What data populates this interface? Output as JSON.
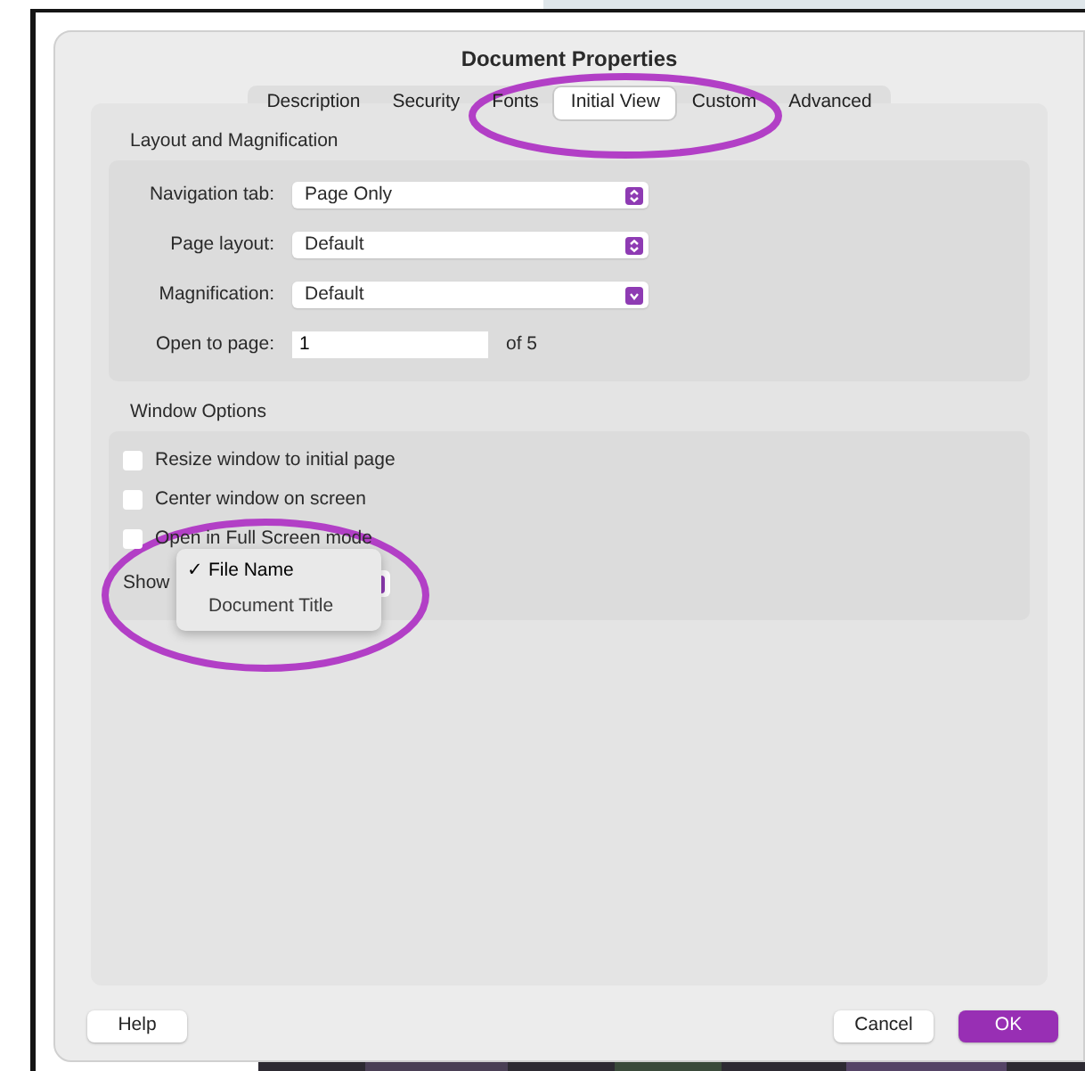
{
  "window": {
    "title": "Document Properties"
  },
  "tabs": [
    {
      "label": "Description",
      "selected": false
    },
    {
      "label": "Security",
      "selected": false
    },
    {
      "label": "Fonts",
      "selected": false
    },
    {
      "label": "Initial View",
      "selected": true
    },
    {
      "label": "Custom",
      "selected": false
    },
    {
      "label": "Advanced",
      "selected": false
    }
  ],
  "layout_group": {
    "title": "Layout and Magnification",
    "fields": [
      {
        "kind": "popup",
        "label": "Navigation tab:",
        "value": "Page Only"
      },
      {
        "kind": "popup",
        "label": "Page layout:",
        "value": "Default"
      },
      {
        "kind": "combo",
        "label": "Magnification:",
        "value": "Default"
      },
      {
        "kind": "input",
        "label": "Open to page:",
        "value": "1",
        "suffix": "of 5"
      }
    ]
  },
  "window_group": {
    "title": "Window Options",
    "checkboxes": [
      {
        "label": "Resize window to initial page",
        "checked": false
      },
      {
        "label": "Center window on screen",
        "checked": false
      },
      {
        "label": "Open in Full Screen mode",
        "checked": false
      }
    ],
    "show": {
      "label": "Show",
      "check_mark": "✓",
      "menu": [
        {
          "label": "File Name",
          "selected": true
        },
        {
          "label": "Document Title",
          "selected": false
        }
      ]
    }
  },
  "buttons": [
    {
      "label": "Help",
      "kind": "default"
    },
    {
      "label": "Cancel",
      "kind": "default"
    },
    {
      "label": "OK",
      "kind": "primary"
    }
  ],
  "annotations": [
    {
      "kind": "ellipse",
      "color": "#b23fc6"
    },
    {
      "kind": "ellipse",
      "color": "#b23fc6"
    }
  ]
}
